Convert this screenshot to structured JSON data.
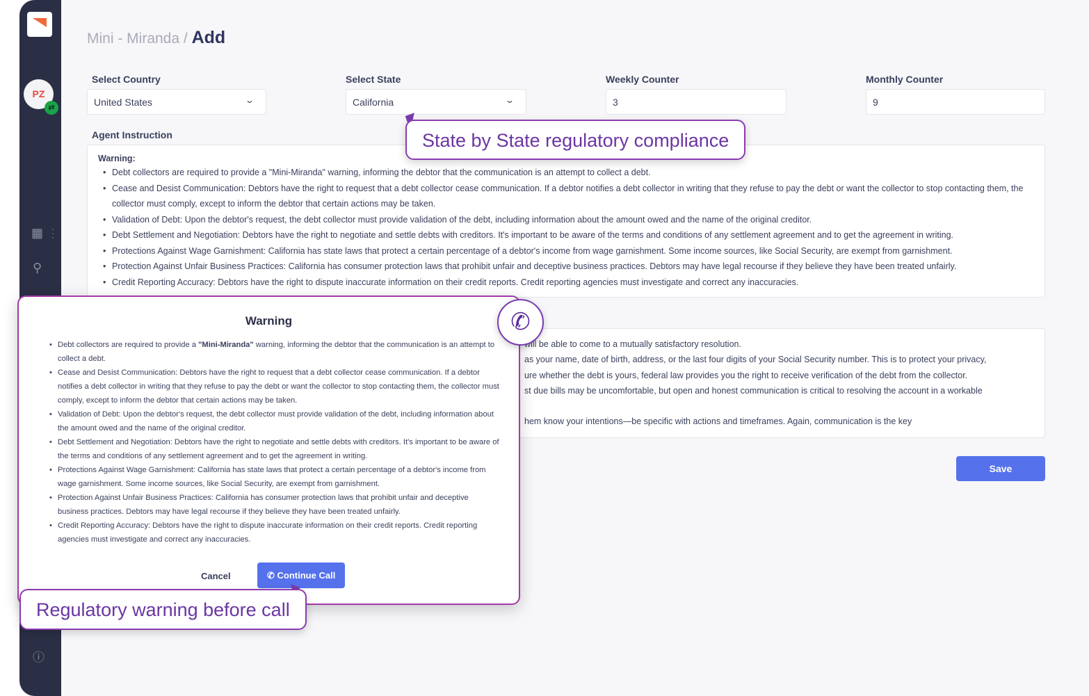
{
  "breadcrumb": {
    "parent": "Mini - Miranda",
    "separator": "/",
    "current": "Add"
  },
  "sidebar": {
    "avatar_initials": "PZ"
  },
  "form": {
    "country": {
      "label": "Select Country",
      "value": "United States"
    },
    "state": {
      "label": "Select State",
      "value": "California"
    },
    "weekly": {
      "label": "Weekly Counter",
      "value": "3"
    },
    "monthly": {
      "label": "Monthly Counter",
      "value": "9"
    },
    "agent_instruction": {
      "label": "Agent Instruction",
      "heading": "Warning:",
      "items": [
        "Debt collectors are required to provide a \"Mini-Miranda\" warning, informing the debtor that the communication is an attempt to collect a debt.",
        "Cease and Desist Communication: Debtors have the right to request that a debt collector cease communication. If a debtor notifies a debt collector in writing that they refuse to pay the debt or want the collector to stop contacting them, the collector must comply, except to inform the debtor that certain actions may be taken.",
        "Validation of Debt: Upon the debtor's request, the debt collector must provide validation of the debt, including information about the amount owed and the name of the original creditor.",
        "Debt Settlement and Negotiation: Debtors have the right to negotiate and settle debts with creditors. It's important to be aware of the terms and conditions of any settlement agreement and to get the agreement in writing.",
        "Protections Against Wage Garnishment: California has state laws that protect a certain percentage of a debtor's income from wage garnishment. Some income sources, like Social Security, are exempt from garnishment.",
        "Protection Against Unfair Business Practices: California has consumer protection laws that prohibit unfair and deceptive business practices. Debtors may have legal recourse if they believe they have been treated unfairly.",
        "Credit Reporting Accuracy: Debtors have the right to dispute inaccurate information on their credit reports. Credit reporting agencies must investigate and correct any inaccuracies."
      ]
    },
    "second_box_lines": [
      "will be able to come to a mutually satisfactory resolution.",
      "as your name, date of birth, address, or the last four digits of your Social Security number. This is to protect your privacy,",
      "ure whether the debt is yours, federal law provides you the right to receive verification of the debt from the collector.",
      "st due bills may be uncomfortable, but open and honest communication is critical to resolving the account in a workable",
      "",
      "hem know your intentions—be specific with actions and timeframes. Again, communication is the key"
    ],
    "save_label": "Save"
  },
  "modal": {
    "title": "Warning",
    "first_item": {
      "pre": "Debt collectors are required to provide a ",
      "bold": "\"Mini-Miranda\"",
      "post": " warning, informing the debtor that the communication is an attempt to collect a debt."
    },
    "items": [
      "Cease and Desist Communication: Debtors have the right to request that a debt collector cease communication. If a debtor notifies a debt collector in writing that they refuse to pay the debt or want the collector to stop contacting them, the collector must comply, except to inform the debtor that certain actions may be taken.",
      "Validation of Debt: Upon the debtor's request, the debt collector must provide validation of the debt, including information about the amount owed and the name of the original creditor.",
      "Debt Settlement and Negotiation: Debtors have the right to negotiate and settle debts with creditors. It's important to be aware of the terms and conditions of any settlement agreement and to get the agreement in writing.",
      "Protections Against Wage Garnishment: California has state laws that protect a certain percentage of a debtor's income from wage garnishment. Some income sources, like Social Security, are exempt from garnishment.",
      "Protection Against Unfair Business Practices: California has consumer protection laws that prohibit unfair and deceptive business practices. Debtors may have legal recourse if they believe they have been treated unfairly.",
      "Credit Reporting Accuracy: Debtors have the right to dispute inaccurate information on their credit reports. Credit reporting agencies must investigate and correct any inaccuracies."
    ],
    "cancel_label": "Cancel",
    "continue_label": "Continue Call"
  },
  "callouts": {
    "state": "State by State regulatory compliance",
    "warning": "Regulatory warning before call"
  },
  "colors": {
    "sidebar": "#2a2f45",
    "primary": "#5571ec",
    "callout": "#6b35a3"
  }
}
